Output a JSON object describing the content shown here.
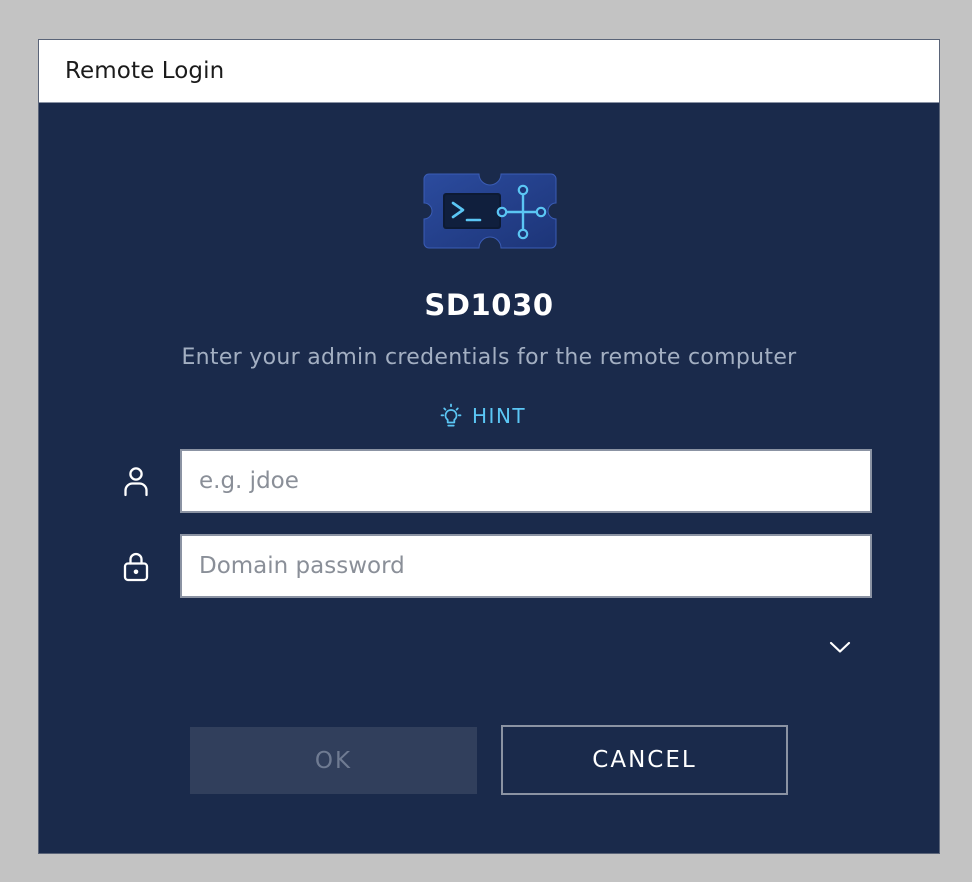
{
  "window": {
    "title": "Remote Login"
  },
  "app_icon": {
    "name": "remote-terminal-app-icon",
    "accent": "#5bc6f4",
    "background": "#24408f"
  },
  "header": {
    "host_name": "SD1030",
    "subtitle": "Enter your admin credentials for the remote computer"
  },
  "hint": {
    "icon": "lightbulb-icon",
    "label": "HINT",
    "color": "#5bc6f4"
  },
  "form": {
    "username": {
      "icon": "user-icon",
      "value": "",
      "placeholder": "e.g. jdoe"
    },
    "password": {
      "icon": "lock-icon",
      "value": "",
      "placeholder": "Domain password"
    },
    "more_options_icon": "chevron-down-icon"
  },
  "buttons": {
    "ok_label": "OK",
    "ok_enabled": false,
    "cancel_label": "CANCEL"
  },
  "colors": {
    "dialog_background": "#1a2a4b",
    "page_background": "#c3c3c3"
  }
}
